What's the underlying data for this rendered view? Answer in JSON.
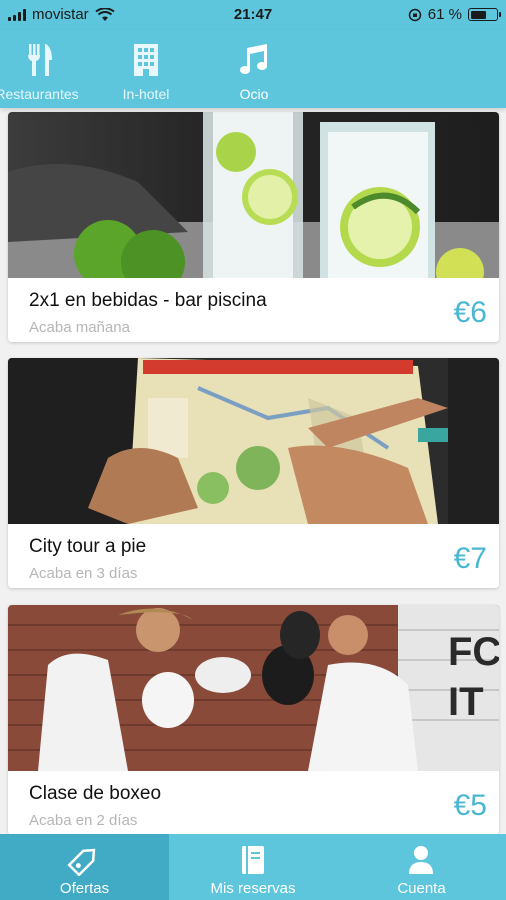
{
  "status_bar": {
    "carrier": "movistar",
    "time": "21:47",
    "battery_text": "61 %",
    "battery_level": 0.61
  },
  "top_tabs": [
    {
      "label": "Restaurantes",
      "icon": "fork-knife-icon",
      "active": false
    },
    {
      "label": "In-hotel",
      "icon": "building-icon",
      "active": false
    },
    {
      "label": "Ocio",
      "icon": "music-note-icon",
      "active": true
    }
  ],
  "offers": [
    {
      "title": "2x1 en bebidas - bar piscina",
      "subtitle": "Acaba mañana",
      "price": "€6",
      "image": "drinks-photo"
    },
    {
      "title": "City tour a pie",
      "subtitle": "Acaba en 3 días",
      "price": "€7",
      "image": "city-map-photo"
    },
    {
      "title": "Clase de boxeo",
      "subtitle": "Acaba en 2 días",
      "price": "€5",
      "image": "boxing-photo"
    }
  ],
  "bottom_nav": [
    {
      "label": "Ofertas",
      "icon": "tag-icon",
      "active": true
    },
    {
      "label": "Mis reservas",
      "icon": "book-icon",
      "active": false
    },
    {
      "label": "Cuenta",
      "icon": "user-icon",
      "active": false
    }
  ],
  "colors": {
    "brand": "#5ec6dc",
    "brand_active": "#41abc5",
    "price": "#4ab7d2"
  }
}
